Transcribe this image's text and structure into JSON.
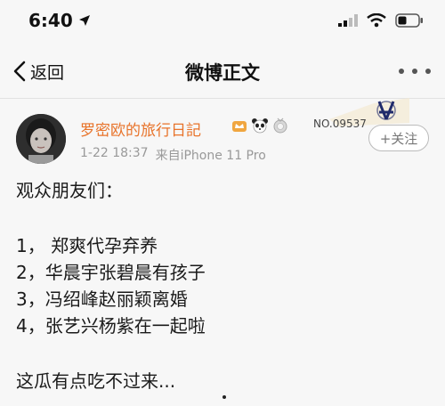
{
  "status_bar": {
    "time": "6:40",
    "icons": [
      "location-arrow-icon",
      "signal-icon",
      "wifi-icon",
      "battery-icon"
    ]
  },
  "nav": {
    "back_label": "返回",
    "title": "微博正文",
    "more_icon": "more-dots-icon"
  },
  "post": {
    "author": "罗密欧的旅行日記",
    "badges": [
      "crown-badge-icon",
      "panda-badge-icon",
      "medal-badge-icon"
    ],
    "date": "1-22 18:37",
    "source": "来自iPhone 11 Pro",
    "fans_number": "NO.09537",
    "follow_label": "+关注",
    "lines": [
      "观众朋友们：",
      "1， 郑爽代孕弃养",
      "2，华晨宇张碧晨有孩子",
      "3，冯绍峰赵丽颖离婚",
      "4，张艺兴杨紫在一起啦",
      "这瓜有点吃不过来..."
    ]
  },
  "colors": {
    "author": "#e8732a",
    "background": "#f7f7f7",
    "meta": "#999999"
  }
}
